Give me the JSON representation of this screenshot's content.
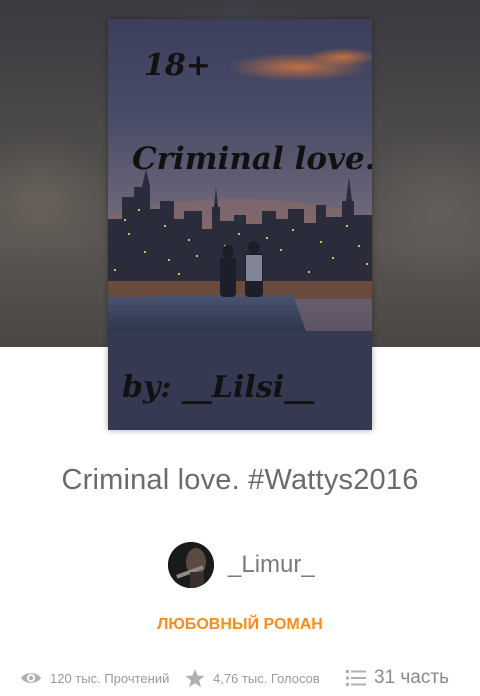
{
  "story": {
    "cover": {
      "line1": "18+",
      "line2": "Criminal love.",
      "line3": "by: __Lilsi__"
    },
    "title": "Criminal love. #Wattys2016",
    "author": "_Limur_",
    "genre": "ЛЮБОВНЫЙ РОМАН"
  },
  "stats": {
    "reads": "120 тыс. Прочтений",
    "votes": "4,76 тыс. Голосов",
    "parts": "31 часть"
  },
  "icons": {
    "reads": "eye-icon",
    "votes": "star-icon",
    "parts": "list-icon"
  },
  "colors": {
    "accent": "#ff8a1a",
    "text": "#6b6b6b",
    "muted": "#9a9a9a"
  }
}
